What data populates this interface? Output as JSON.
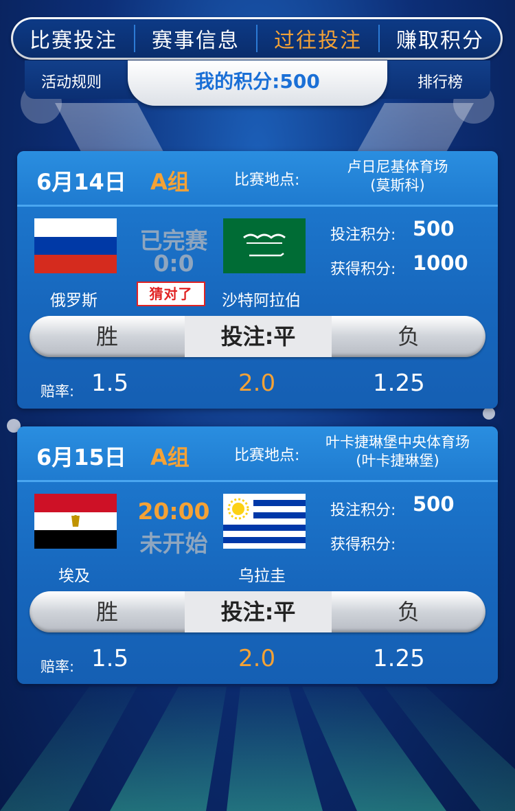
{
  "nav": {
    "tabs": [
      "比赛投注",
      "赛事信息",
      "过往投注",
      "赚取积分"
    ],
    "active_index": 2,
    "rules_link": "活动规则",
    "points_label": "我的积分:500",
    "leaderboard_link": "排行榜"
  },
  "colors": {
    "accent_orange": "#f4a236",
    "card_blue": "#1f7ed4",
    "points_blue": "#1a6fd6",
    "badge_red": "#e02323"
  },
  "matches": [
    {
      "date": "6月14日",
      "group": "A组",
      "venue_label": "比赛地点:",
      "venue_line1": "卢日尼基体育场",
      "venue_line2": "(莫斯科)",
      "home_team": "俄罗斯",
      "home_flag": "russia-flag-icon",
      "away_team": "沙特阿拉伯",
      "away_flag": "saudi-arabia-flag-icon",
      "status_line1": "已完赛",
      "status_line2": "0:0",
      "result_badge": "猜对了",
      "bet_points_label": "投注积分:",
      "bet_points": "500",
      "earned_points_label": "获得积分:",
      "earned_points": "1000",
      "options": {
        "win": "胜",
        "draw": "投注:平",
        "lose": "负"
      },
      "odds_label": "赔率:",
      "odds": [
        "1.5",
        "2.0",
        "1.25"
      ]
    },
    {
      "date": "6月15日",
      "group": "A组",
      "venue_label": "比赛地点:",
      "venue_line1": "叶卡捷琳堡中央体育场",
      "venue_line2": "(叶卡捷琳堡)",
      "home_team": "埃及",
      "home_flag": "egypt-flag-icon",
      "away_team": "乌拉圭",
      "away_flag": "uruguay-flag-icon",
      "status_line1": "20:00",
      "status_line2": "未开始",
      "bet_points_label": "投注积分:",
      "bet_points": "500",
      "earned_points_label": "获得积分:",
      "earned_points": "",
      "options": {
        "win": "胜",
        "draw": "投注:平",
        "lose": "负"
      },
      "odds_label": "赔率:",
      "odds": [
        "1.5",
        "2.0",
        "1.25"
      ]
    }
  ]
}
